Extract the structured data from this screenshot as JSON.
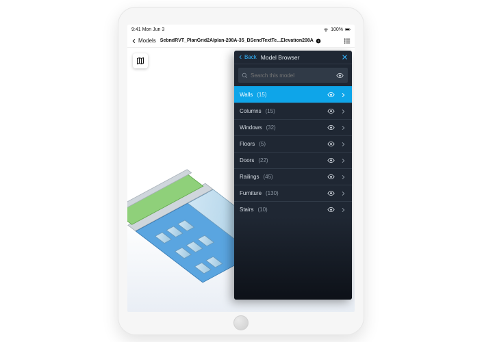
{
  "status": {
    "time": "9:41",
    "day": "Mon Jun 3",
    "battery": "100%"
  },
  "nav": {
    "back_label": "Models",
    "title": "SebndRVT_PlanGrid2Alplan-208A-35_BSendTextTe...Elevation208A"
  },
  "panel": {
    "back_label": "Back",
    "title": "Model Browser",
    "search_placeholder": "Search this model"
  },
  "categories": [
    {
      "name": "Walls",
      "count": "(15)",
      "selected": true
    },
    {
      "name": "Columns",
      "count": "(15)",
      "selected": false
    },
    {
      "name": "Windows",
      "count": "(32)",
      "selected": false
    },
    {
      "name": "Floors",
      "count": "(5)",
      "selected": false
    },
    {
      "name": "Doors",
      "count": "(22)",
      "selected": false
    },
    {
      "name": "Railings",
      "count": "(45)",
      "selected": false
    },
    {
      "name": "Furniture",
      "count": "(130)",
      "selected": false
    },
    {
      "name": "Stairs",
      "count": "(10)",
      "selected": false
    }
  ]
}
